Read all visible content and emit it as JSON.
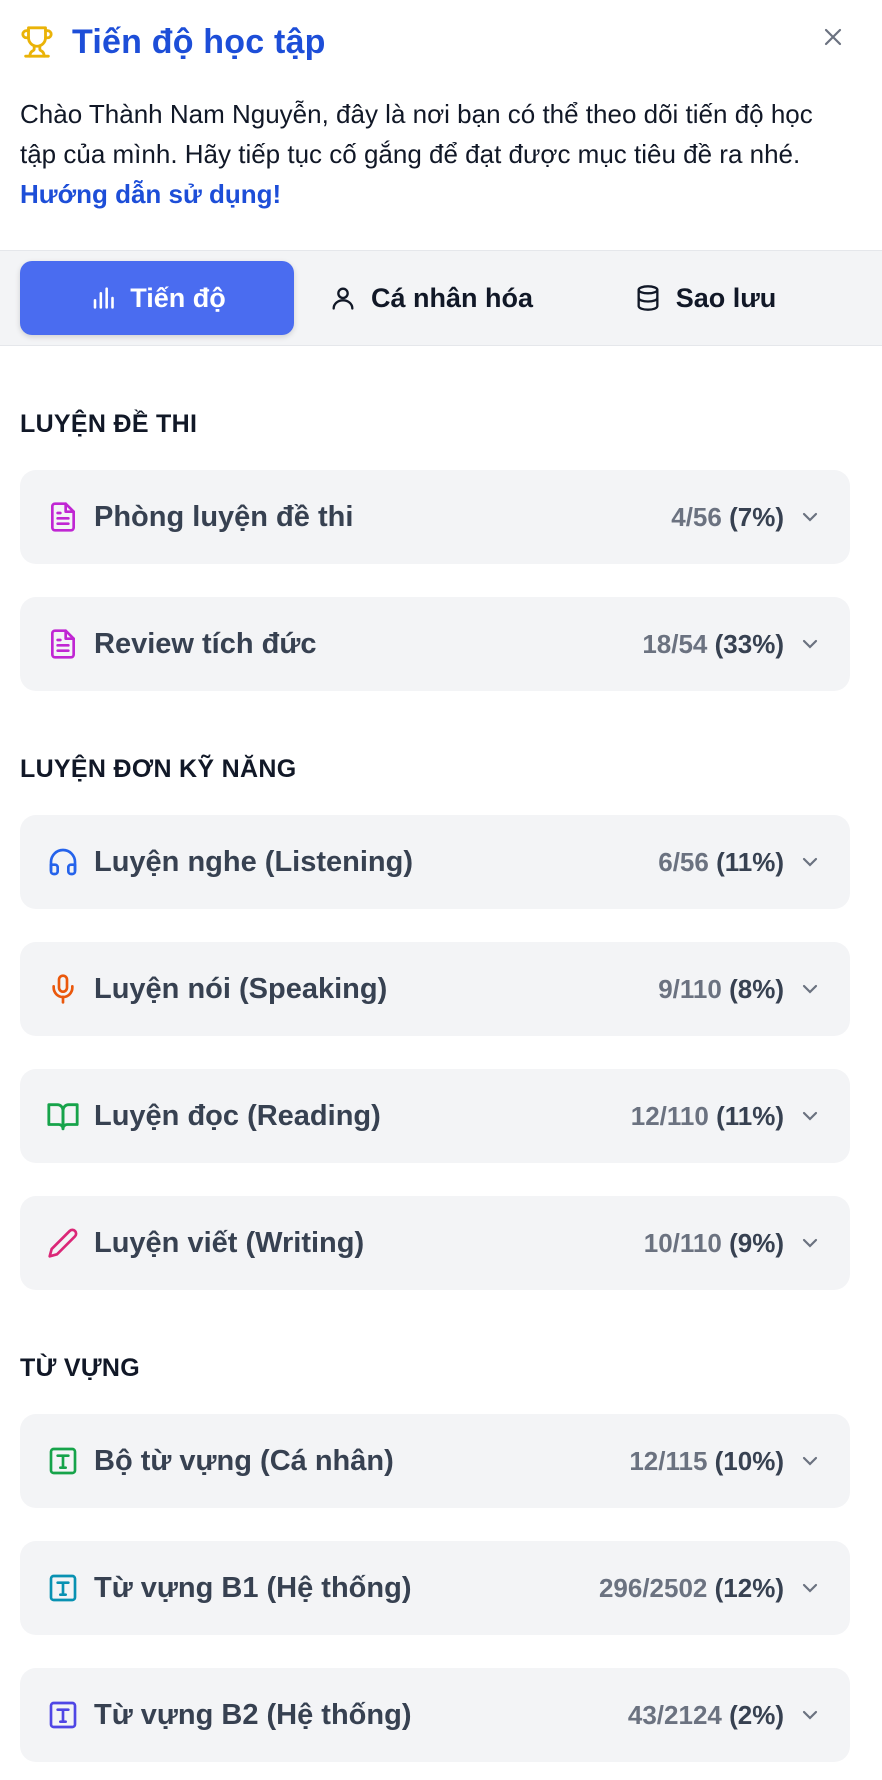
{
  "header": {
    "title": "Tiến độ học tập",
    "intro_text": "Chào Thành Nam Nguyễn, đây là nơi bạn có thể theo dõi tiến độ học tập của mình. Hãy tiếp tục cố gắng để đạt được mục tiêu đề ra nhé.",
    "guide_link": "Hướng dẫn sử dụng!"
  },
  "tabs": [
    {
      "label": "Tiến độ",
      "icon": "bar-chart-icon",
      "active": true
    },
    {
      "label": "Cá nhân hóa",
      "icon": "user-icon",
      "active": false
    },
    {
      "label": "Sao lưu",
      "icon": "database-icon",
      "active": false
    }
  ],
  "sections": {
    "exam": {
      "title": "LUYỆN ĐỀ THI",
      "items": [
        {
          "name": "Phòng luyện đề thi",
          "count": "4/56",
          "pct": "(7%)",
          "icon": "document-icon",
          "color": "#c026d3"
        },
        {
          "name": "Review tích đức",
          "count": "18/54",
          "pct": "(33%)",
          "icon": "document-icon",
          "color": "#c026d3"
        }
      ]
    },
    "skills": {
      "title": "LUYỆN ĐƠN KỸ NĂNG",
      "items": [
        {
          "name": "Luyện nghe (Listening)",
          "count": "6/56",
          "pct": "(11%)",
          "icon": "headphones-icon",
          "color": "#2563eb"
        },
        {
          "name": "Luyện nói (Speaking)",
          "count": "9/110",
          "pct": "(8%)",
          "icon": "microphone-icon",
          "color": "#ea580c"
        },
        {
          "name": "Luyện đọc (Reading)",
          "count": "12/110",
          "pct": "(11%)",
          "icon": "book-open-icon",
          "color": "#16a34a"
        },
        {
          "name": "Luyện viết (Writing)",
          "count": "10/110",
          "pct": "(9%)",
          "icon": "pencil-icon",
          "color": "#db2777"
        }
      ]
    },
    "vocab": {
      "title": "TỪ VỰNG",
      "items": [
        {
          "name": "Bộ từ vựng (Cá nhân)",
          "count": "12/115",
          "pct": "(10%)",
          "icon": "text-box-icon",
          "color": "#16a34a"
        },
        {
          "name": "Từ vựng B1 (Hệ thống)",
          "count": "296/2502",
          "pct": "(12%)",
          "icon": "text-box-icon",
          "color": "#0891b2"
        },
        {
          "name": "Từ vựng B2 (Hệ thống)",
          "count": "43/2124",
          "pct": "(2%)",
          "icon": "text-box-icon",
          "color": "#4f46e5"
        }
      ]
    }
  },
  "colors": {
    "accent": "#1d4ed8",
    "active_tab": "#4a6cf0",
    "trophy": "#eab308"
  }
}
